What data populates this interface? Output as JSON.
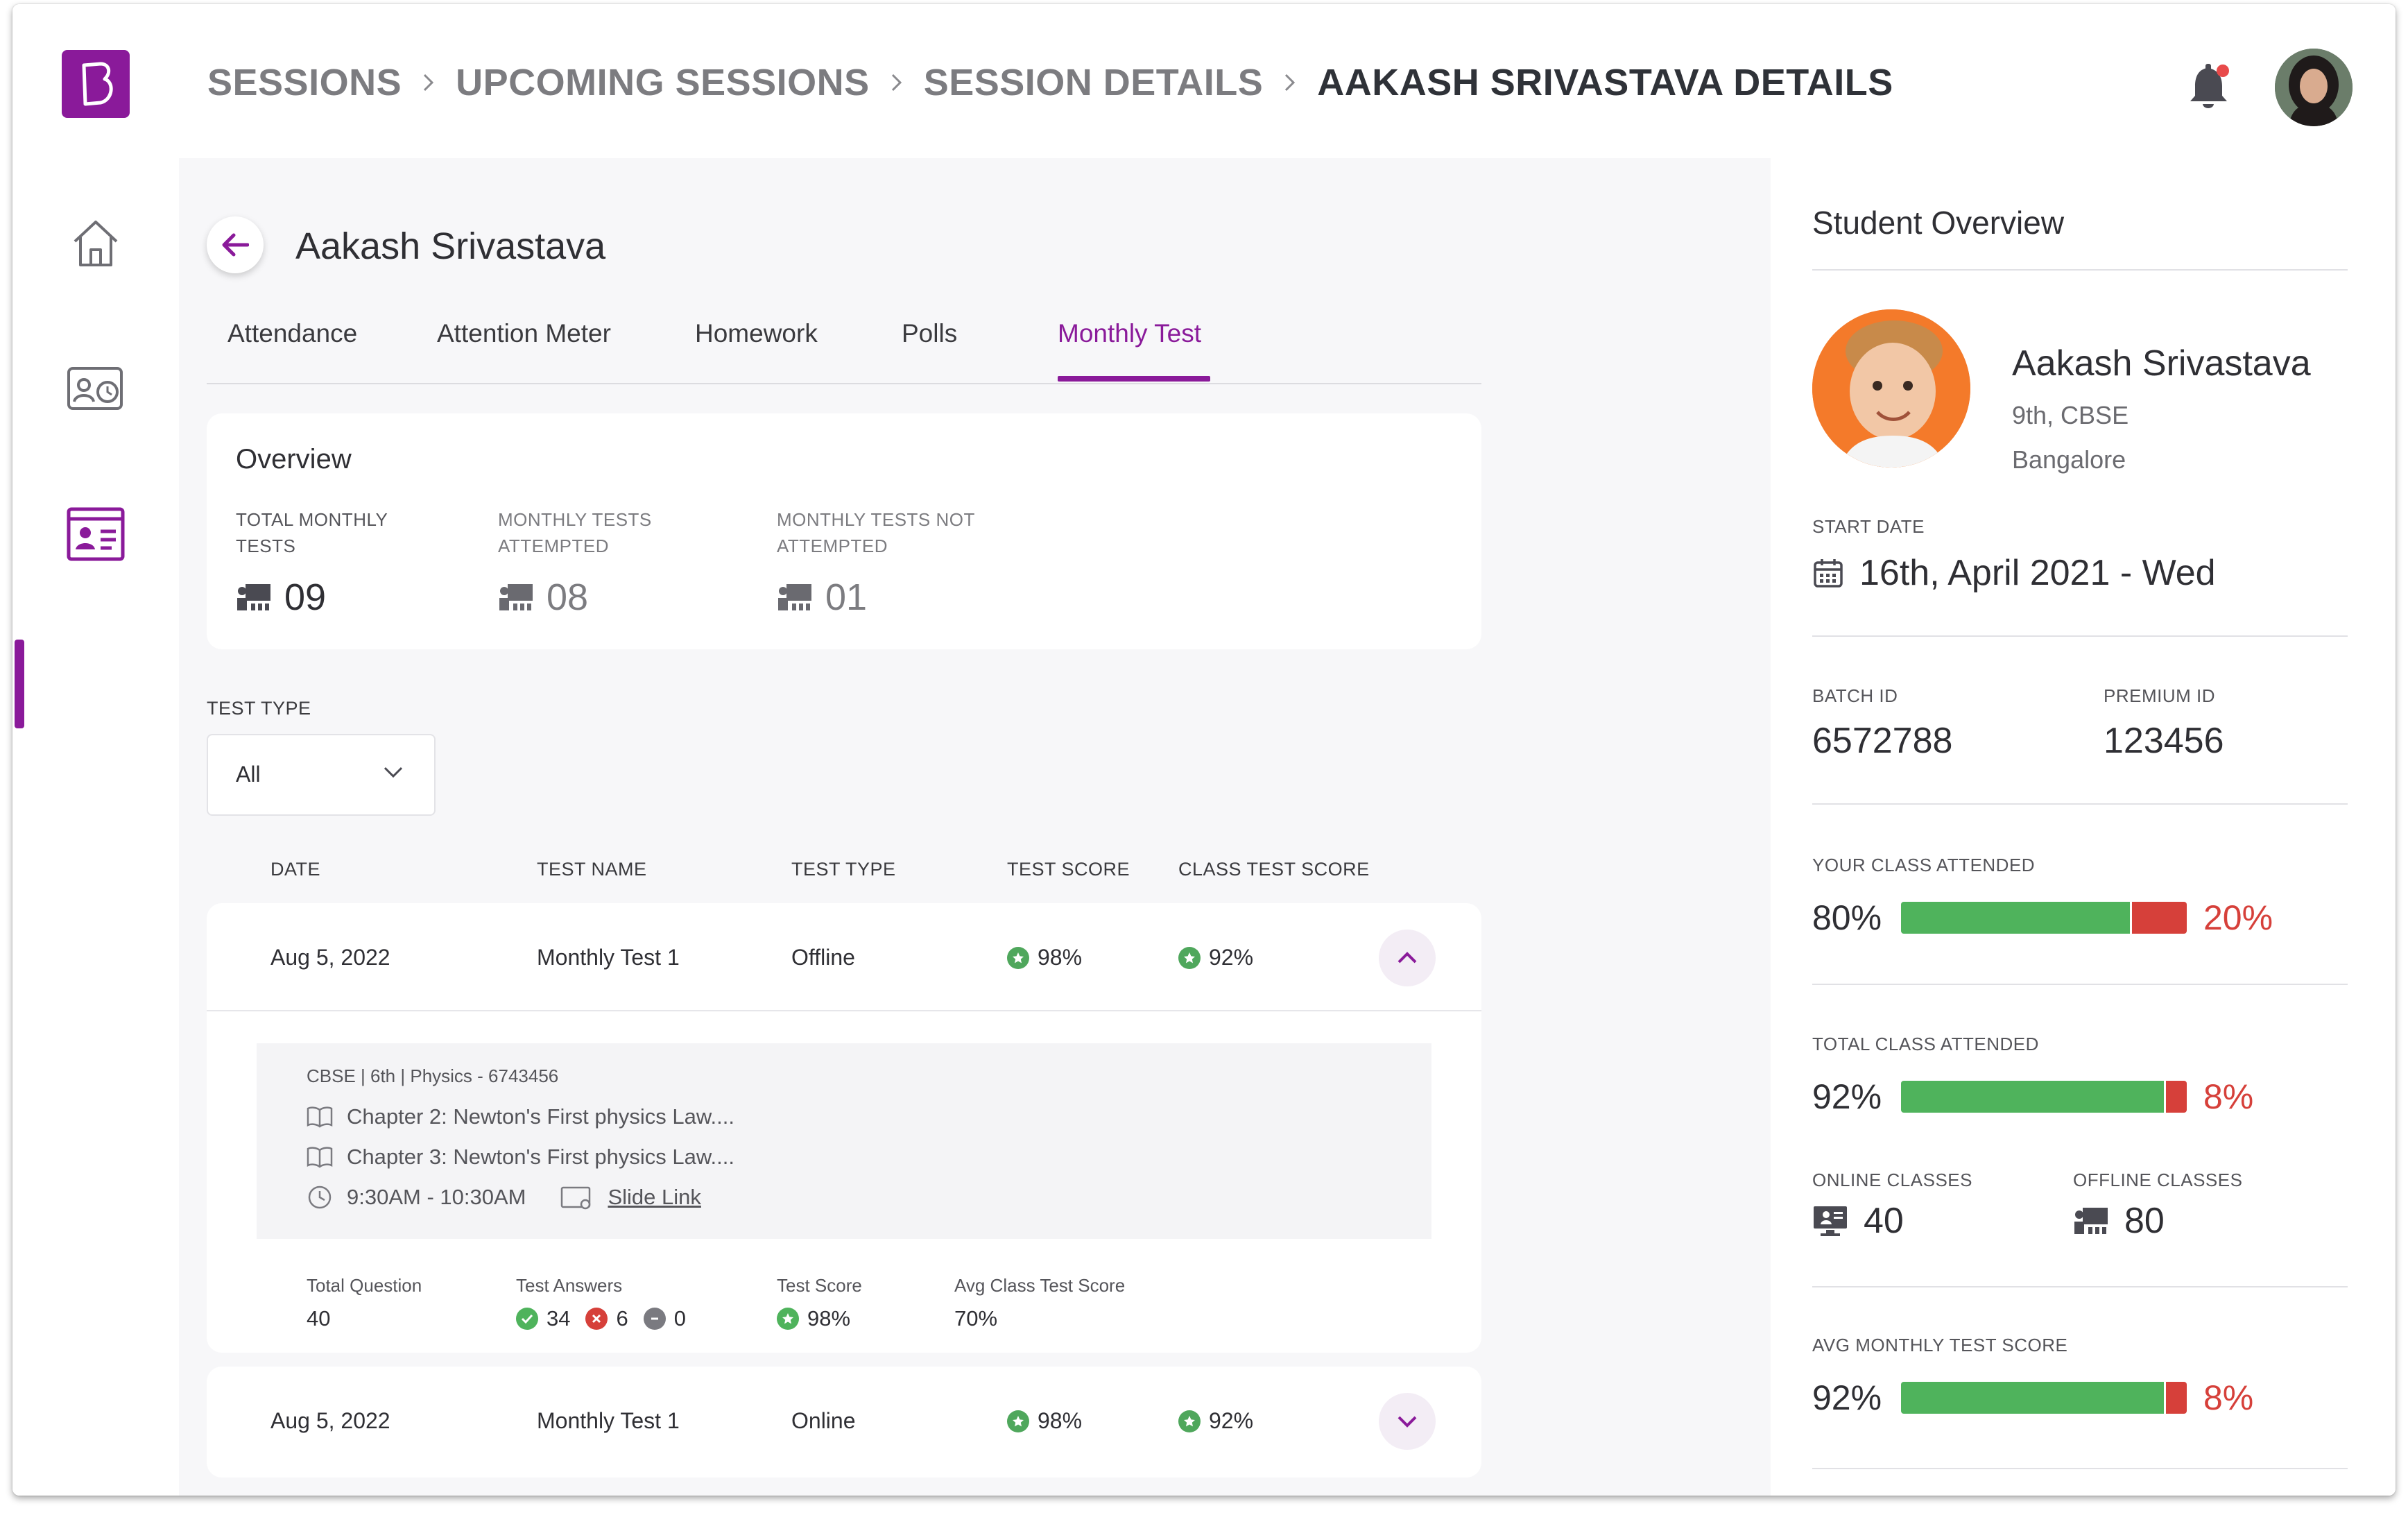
{
  "breadcrumb": {
    "items": [
      "SESSIONS",
      "UPCOMING SESSIONS",
      "SESSION DETAILS"
    ],
    "current": "AAKASH SRIVASTAVA DETAILS"
  },
  "student": {
    "name": "Aakash Srivastava"
  },
  "tabs": [
    "Attendance",
    "Attention Meter",
    "Homework",
    "Polls",
    "Monthly Test"
  ],
  "active_tab": "Monthly Test",
  "overview": {
    "title": "Overview",
    "stats": [
      {
        "label": "TOTAL MONTHLY TESTS",
        "value": "09"
      },
      {
        "label": "MONTHLY TESTS ATTEMPTED",
        "value": "08"
      },
      {
        "label": "MONTHLY TESTS NOT ATTEMPTED",
        "value": "01"
      }
    ]
  },
  "filter": {
    "label": "TEST TYPE",
    "value": "All"
  },
  "table": {
    "headers": [
      "DATE",
      "TEST NAME",
      "TEST TYPE",
      "TEST SCORE",
      "CLASS TEST SCORE"
    ],
    "rows": [
      {
        "date": "Aug 5, 2022",
        "name": "Monthly Test 1",
        "type": "Offline",
        "score": "98%",
        "class_score": "92%",
        "expanded": true,
        "details": {
          "meta": "CBSE | 6th | Physics - 6743456",
          "chapters": [
            "Chapter 2: Newton's First physics Law....",
            "Chapter 3: Newton's First physics Law...."
          ],
          "time": "9:30AM - 10:30AM",
          "slide_link": "Slide Link",
          "total_question_label": "Total Question",
          "total_question": "40",
          "answers_label": "Test Answers",
          "answers": {
            "correct": "34",
            "wrong": "6",
            "skipped": "0"
          },
          "test_score_label": "Test Score",
          "test_score": "98%",
          "avg_label": "Avg Class Test Score",
          "avg": "70%"
        }
      },
      {
        "date": "Aug 5, 2022",
        "name": "Monthly Test 1",
        "type": "Online",
        "score": "98%",
        "class_score": "92%",
        "expanded": false
      }
    ]
  },
  "overview_panel": {
    "title": "Student Overview",
    "name": "Aakash Srivastava",
    "grade": "9th, CBSE",
    "city": "Bangalore",
    "start_date_label": "START DATE",
    "start_date": "16th, April 2021 - Wed",
    "batch_id_label": "BATCH ID",
    "batch_id": "6572788",
    "premium_id_label": "PREMIUM ID",
    "premium_id": "123456",
    "your_class": {
      "label": "YOUR CLASS ATTENDED",
      "attended": "80%",
      "missed": "20%",
      "fraction": 0.8
    },
    "total_class": {
      "label": "TOTAL CLASS ATTENDED",
      "attended": "92%",
      "missed": "8%",
      "fraction": 0.92
    },
    "online_label": "ONLINE CLASSES",
    "online": "40",
    "offline_label": "OFFLINE CLASSES",
    "offline": "80",
    "avg_test": {
      "label": "AVG MONTHLY TEST SCORE",
      "attended": "92%",
      "missed": "8%",
      "fraction": 0.92
    }
  },
  "colors": {
    "accent": "#8a1a9a",
    "success": "#4fb35c",
    "danger": "#d6403a"
  },
  "icons": [
    "home-icon",
    "schedule-card-icon",
    "profile-card-icon",
    "bell-icon",
    "back-arrow-icon",
    "chevron-down-icon",
    "chevron-up-icon",
    "classroom-icon",
    "book-icon",
    "clock-icon",
    "slide-icon",
    "calendar-icon",
    "monitor-icon",
    "star-badge-icon"
  ]
}
